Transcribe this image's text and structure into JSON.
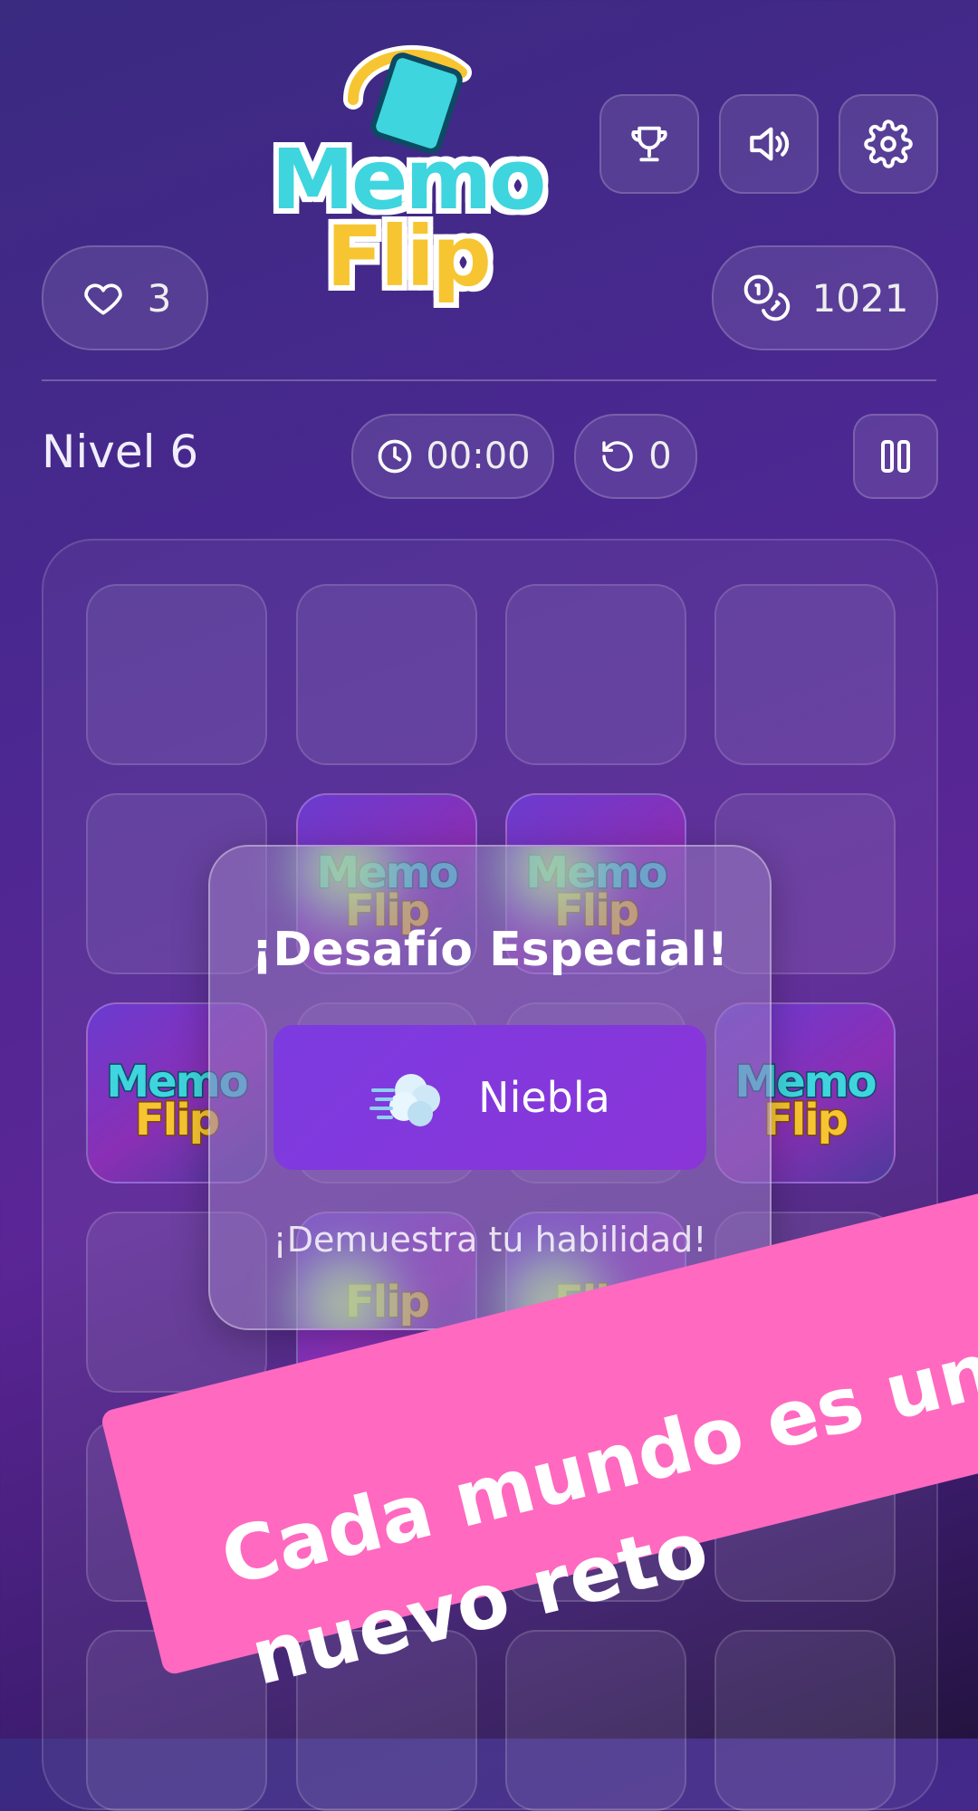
{
  "logo": {
    "line1": "Memo",
    "line2": "Flip"
  },
  "header": {
    "buttons": [
      {
        "icon": "trophy-icon"
      },
      {
        "icon": "speaker-icon"
      },
      {
        "icon": "gear-icon"
      }
    ],
    "lives": {
      "icon": "heart-icon",
      "value": "3"
    },
    "coins": {
      "icon": "coins-icon",
      "value": "1021"
    }
  },
  "status": {
    "level": "Nivel 6",
    "timer": "00:00",
    "moves": "0"
  },
  "card_logo": {
    "line1": "Memo",
    "line2": "Flip"
  },
  "modal": {
    "title": "¡Desafío Especial!",
    "challenge": "Niebla",
    "challenge_icon": "wind-cloud-icon",
    "subtitle": "¡Demuestra tu habilidad!"
  },
  "banner": {
    "line1": "Cada mundo es un",
    "line2": "nuevo reto"
  },
  "colors": {
    "banner": "#ff69c0",
    "chip": "#7c3be0",
    "logo_memo": "#3ed5de",
    "logo_flip": "#f7c531"
  }
}
